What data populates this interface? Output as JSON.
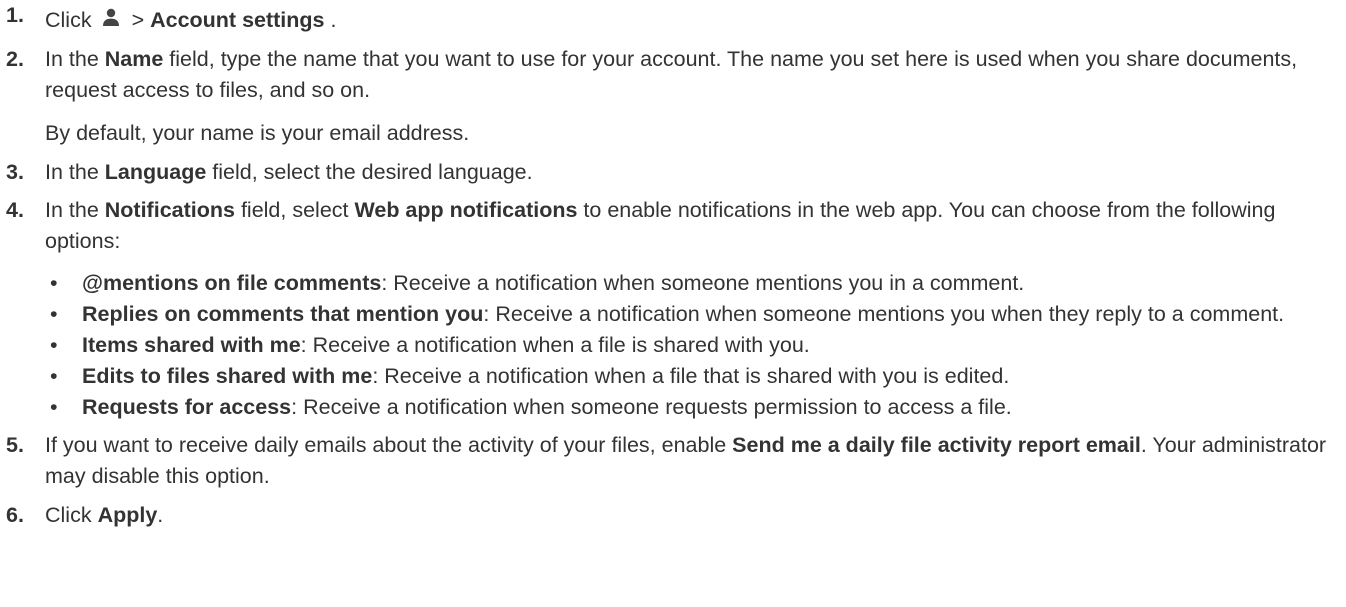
{
  "steps": [
    {
      "number": "1.",
      "segments": [
        {
          "text": "Click",
          "bold": false
        },
        {
          "icon": "person-icon"
        },
        {
          "text": "> ",
          "bold": false
        },
        {
          "text": "Account settings",
          "bold": true
        },
        {
          "text": ".",
          "bold": false
        }
      ]
    },
    {
      "number": "2.",
      "segments": [
        {
          "text": "In the ",
          "bold": false
        },
        {
          "text": "Name",
          "bold": true
        },
        {
          "text": " field, type the name that you want to use for your account. The name you set here is used when you share documents, request access to files, and so on.",
          "bold": false
        }
      ],
      "note": "By default, your name is your email address."
    },
    {
      "number": "3.",
      "segments": [
        {
          "text": "In the ",
          "bold": false
        },
        {
          "text": "Language",
          "bold": true
        },
        {
          "text": " field, select the desired language.",
          "bold": false
        }
      ]
    },
    {
      "number": "4.",
      "segments": [
        {
          "text": "In the ",
          "bold": false
        },
        {
          "text": "Notifications",
          "bold": true
        },
        {
          "text": " field, select ",
          "bold": false
        },
        {
          "text": "Web app notifications",
          "bold": true
        },
        {
          "text": " to enable notifications in the web app. You can choose from the following options:",
          "bold": false
        }
      ],
      "bullets": [
        {
          "title": "@mentions on file comments",
          "text": ": Receive a notification when someone mentions you in a comment."
        },
        {
          "title": "Replies on comments that mention you",
          "text": ": Receive a notification when someone mentions you when they reply to a comment."
        },
        {
          "title": "Items shared with me",
          "text": ": Receive a notification when a file is shared with you."
        },
        {
          "title": "Edits to files shared with me",
          "text": ": Receive a notification when a file that is shared with you is edited."
        },
        {
          "title": "Requests for access",
          "text": ": Receive a notification when someone requests permission to access a file."
        }
      ]
    },
    {
      "number": "5.",
      "segments": [
        {
          "text": "If you want to receive daily emails about the activity of your files, enable ",
          "bold": false
        },
        {
          "text": "Send me a daily file activity report email",
          "bold": true
        },
        {
          "text": ". Your administrator may disable this option.",
          "bold": false
        }
      ]
    },
    {
      "number": "6.",
      "segments": [
        {
          "text": "Click ",
          "bold": false
        },
        {
          "text": "Apply",
          "bold": true
        },
        {
          "text": ".",
          "bold": false
        }
      ]
    }
  ],
  "bullet_glyph": "•",
  "text_color": "#333333",
  "icon_color": "#444444"
}
